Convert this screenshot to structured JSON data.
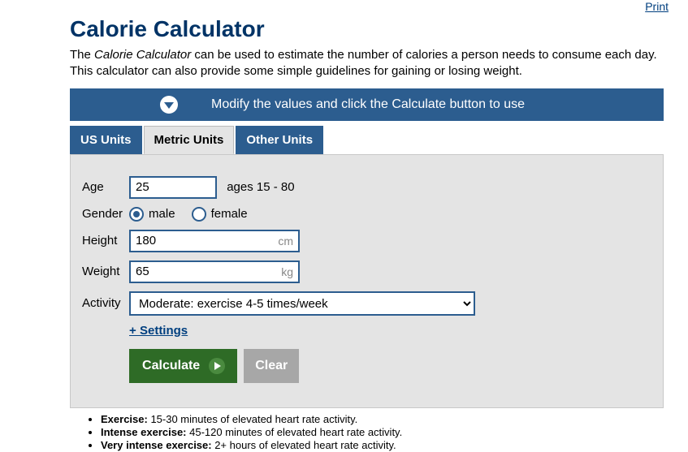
{
  "printLabel": "Print",
  "title": "Calorie Calculator",
  "descPrefix": "The ",
  "descEm": "Calorie Calculator",
  "descRest": " can be used to estimate the number of calories a person needs to consume each day. This calculator can also provide some simple guidelines for gaining or losing weight.",
  "bannerText": "Modify the values and click the Calculate button to use",
  "tabs": {
    "us": "US Units",
    "metric": "Metric Units",
    "other": "Other Units"
  },
  "labels": {
    "age": "Age",
    "gender": "Gender",
    "height": "Height",
    "weight": "Weight",
    "activity": "Activity"
  },
  "ageValue": "25",
  "ageHint": "ages 15 - 80",
  "genderOptions": {
    "male": "male",
    "female": "female"
  },
  "genderSelected": "male",
  "heightValue": "180",
  "heightUnit": "cm",
  "weightValue": "65",
  "weightUnit": "kg",
  "activitySelected": "Moderate: exercise 4-5 times/week",
  "settingsLabel": "+ Settings",
  "calcLabel": "Calculate",
  "clearLabel": "Clear",
  "notes": [
    {
      "b": "Exercise:",
      "t": " 15-30 minutes of elevated heart rate activity."
    },
    {
      "b": "Intense exercise:",
      "t": " 45-120 minutes of elevated heart rate activity."
    },
    {
      "b": "Very intense exercise:",
      "t": " 2+ hours of elevated heart rate activity."
    }
  ]
}
